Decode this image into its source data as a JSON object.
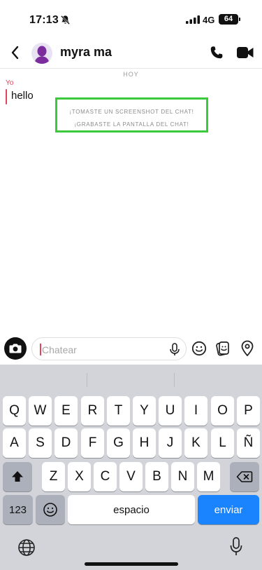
{
  "status": {
    "time": "17:13",
    "network": "4G",
    "battery": "64"
  },
  "header": {
    "contact_name": "myra ma"
  },
  "chat": {
    "date_label": "HOY",
    "sender": "Yo",
    "message": "hello",
    "notices": [
      "¡TOMASTE UN SCREENSHOT DEL CHAT!",
      "¡GRABASTE LA PANTALLA DEL CHAT!"
    ]
  },
  "composer": {
    "placeholder": "Chatear"
  },
  "keyboard": {
    "row1": [
      "Q",
      "W",
      "E",
      "R",
      "T",
      "Y",
      "U",
      "I",
      "O",
      "P"
    ],
    "row2": [
      "A",
      "S",
      "D",
      "F",
      "G",
      "H",
      "J",
      "K",
      "L",
      "Ñ"
    ],
    "row3": [
      "Z",
      "X",
      "C",
      "V",
      "B",
      "N",
      "M"
    ],
    "numbers_label": "123",
    "space_label": "espacio",
    "send_label": "enviar"
  },
  "colors": {
    "accent": "#e0455b",
    "highlight": "#3cc93c",
    "send": "#1a84ff"
  }
}
